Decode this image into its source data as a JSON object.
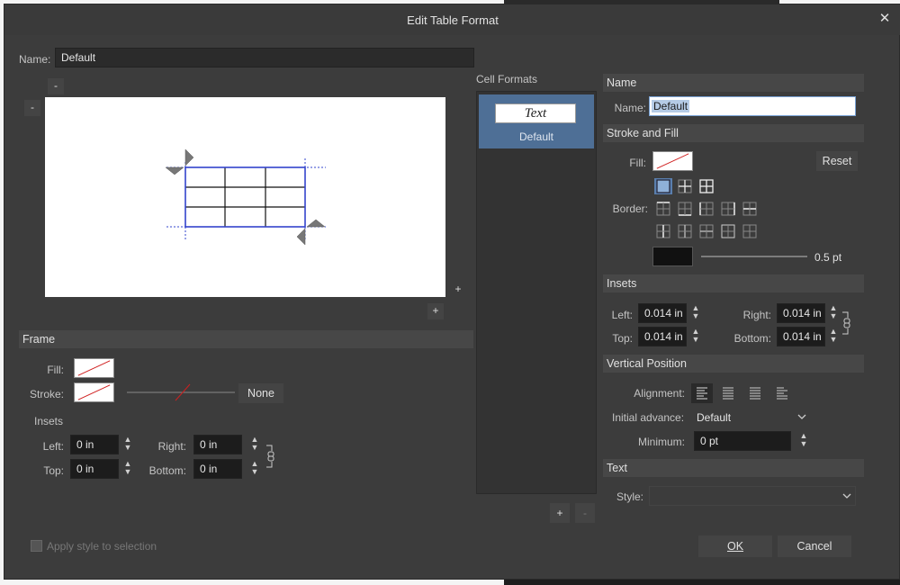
{
  "dialog": {
    "title": "Edit Table Format",
    "close_glyph": "✕"
  },
  "left": {
    "name_label": "Name:",
    "name_value": "Default",
    "minus_top": "-",
    "minus_left": "-",
    "plus_right": "+",
    "plus_bottom": "+"
  },
  "frame": {
    "header": "Frame",
    "fill_label": "Fill:",
    "stroke_label": "Stroke:",
    "stroke_value": "None",
    "insets_label": "Insets",
    "left_label": "Left:",
    "left_value": "0 in",
    "right_label": "Right:",
    "right_value": "0 in",
    "top_label": "Top:",
    "top_value": "0 in",
    "bottom_label": "Bottom:",
    "bottom_value": "0 in"
  },
  "cell_formats": {
    "header": "Cell Formats",
    "items": [
      {
        "preview": "Text",
        "label": "Default"
      }
    ],
    "add": "+",
    "remove": "-"
  },
  "right": {
    "name_header": "Name",
    "name_label": "Name:",
    "name_value": "Default",
    "stroke_fill_header": "Stroke and Fill",
    "fill_label": "Fill:",
    "reset": "Reset",
    "border_label": "Border:",
    "stroke_width": "0.5 pt",
    "insets_header": "Insets",
    "left_label": "Left:",
    "left_value": "0.014 in",
    "right_label": "Right:",
    "right_value": "0.014 in",
    "top_label": "Top:",
    "top_value": "0.014 in",
    "bottom_label": "Bottom:",
    "bottom_value": "0.014 in",
    "vpos_header": "Vertical Position",
    "alignment_label": "Alignment:",
    "initial_advance_label": "Initial advance:",
    "initial_advance_value": "Default",
    "minimum_label": "Minimum:",
    "minimum_value": "0 pt",
    "text_header": "Text",
    "style_label": "Style:",
    "style_value": ""
  },
  "footer": {
    "apply_label": "Apply style to selection",
    "ok": "OK",
    "cancel": "Cancel"
  },
  "colors": {
    "dialog_bg": "#3c3c3c",
    "selected_cell_format": "#4e6f96",
    "selection_highlight": "#b5cbe6",
    "table_blue": "#3344cc"
  }
}
